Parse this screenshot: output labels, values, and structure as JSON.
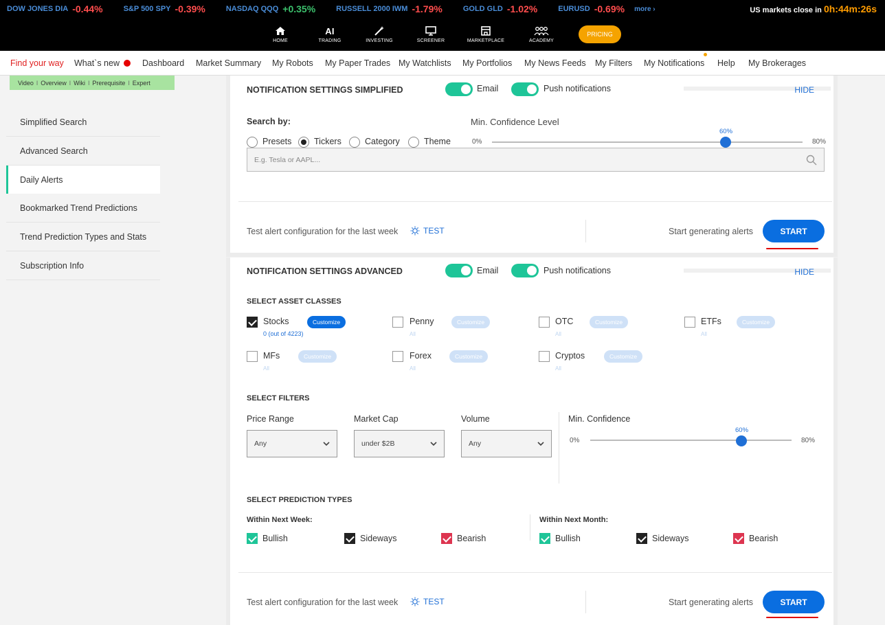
{
  "ticker": {
    "items": [
      {
        "name": "DOW JONES DIA",
        "value": "-0.44%",
        "dir": "neg"
      },
      {
        "name": "S&P 500 SPY",
        "value": "-0.39%",
        "dir": "neg"
      },
      {
        "name": "NASDAQ QQQ",
        "value": "+0.35%",
        "dir": "pos"
      },
      {
        "name": "RUSSELL 2000 IWM",
        "value": "-1.79%",
        "dir": "neg"
      },
      {
        "name": "GOLD GLD",
        "value": "-1.02%",
        "dir": "neg"
      },
      {
        "name": "EURUSD",
        "value": "-0.69%",
        "dir": "neg"
      }
    ],
    "more": "more ›",
    "close_label": "US markets close in",
    "close_time": "0h:44m:26s"
  },
  "nav": {
    "home": "HOME",
    "trading_top": "AI",
    "trading": "TRADING",
    "investing": "INVESTING",
    "screener": "SCREENER",
    "marketplace": "MARKETPLACE",
    "academy": "ACADEMY",
    "pricing": "PRICING"
  },
  "submenu": {
    "find_way": "Find your way",
    "whats_new": "What`s new",
    "dashboard": "Dashboard",
    "market_summary": "Market Summary",
    "my_robots": "My Robots",
    "my_paper_trades": "My Paper Trades",
    "my_watchlists": "My Watchlists",
    "my_portfolios": "My Portfolios",
    "my_news_feeds": "My News Feeds",
    "my_filters": "My Filters",
    "my_notifications": "My Notifications",
    "help": "Help",
    "my_brokerages": "My Brokerages"
  },
  "sidebar": {
    "links": [
      "Video",
      "Overview",
      "Wiki",
      "Prerequisite",
      "Expert"
    ],
    "items": [
      "Simplified Search",
      "Advanced Search",
      "Daily Alerts",
      "Bookmarked Trend Predictions",
      "Trend Prediction Types and Stats",
      "Subscription Info"
    ]
  },
  "simplified": {
    "title": "NOTIFICATION SETTINGS SIMPLIFIED",
    "email": "Email",
    "push": "Push notifications",
    "hide": "HIDE",
    "search_by": "Search by:",
    "options": [
      "Presets",
      "Tickers",
      "Category",
      "Theme"
    ],
    "selected_option": "Tickers",
    "confidence_label": "Min. Confidence Level",
    "min": "0%",
    "max": "80%",
    "value": "60%",
    "level": 0.75,
    "placeholder": "E.g. Tesla or AAPL...",
    "test_text": "Test alert configuration for the last week",
    "test": "TEST",
    "start_text": "Start generating alerts",
    "start": "START"
  },
  "advanced": {
    "title": "NOTIFICATION SETTINGS ADVANCED",
    "email": "Email",
    "push": "Push notifications",
    "hide": "HIDE",
    "asset_classes_title": "SELECT ASSET CLASSES",
    "customize": "Customize",
    "all": "All",
    "stocks_count": "0 (out of 4223)",
    "assets": [
      "Stocks",
      "Penny",
      "OTC",
      "ETFs",
      "MFs",
      "Forex",
      "Cryptos"
    ],
    "filters_title": "SELECT FILTERS",
    "price_range": "Price Range",
    "price_value": "Any",
    "market_cap": "Market Cap",
    "market_cap_value": "under $2B",
    "volume": "Volume",
    "volume_value": "Any",
    "min_conf": "Min. Confidence",
    "min": "0%",
    "max": "80%",
    "value": "60%",
    "level": 0.75,
    "types_title": "SELECT PREDICTION TYPES",
    "week": "Within Next Week:",
    "month": "Within Next Month:",
    "bullish": "Bullish",
    "sideways": "Sideways",
    "bearish": "Bearish",
    "test_text": "Test alert configuration for the last week",
    "test": "TEST",
    "start_text": "Start generating alerts",
    "start": "START"
  },
  "colors": {
    "accent_green": "#1ec598",
    "accent_blue": "#0a6ee0",
    "pricing": "#f5a300",
    "bearish": "#dd3550"
  }
}
